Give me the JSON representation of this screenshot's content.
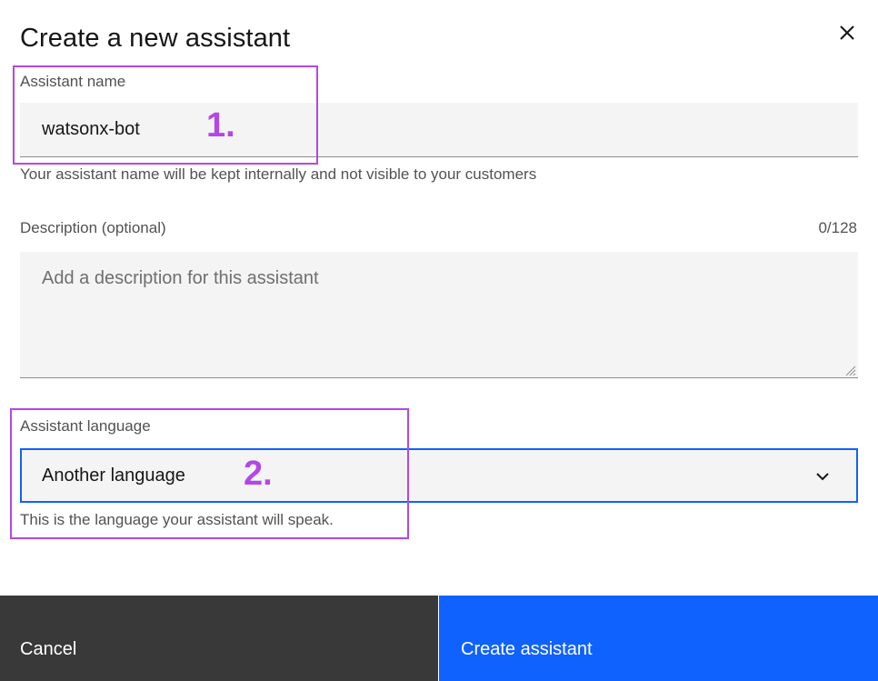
{
  "modal": {
    "title": "Create a new assistant",
    "close_icon": "close-icon"
  },
  "name_field": {
    "label": "Assistant name",
    "value": "watsonx-bot",
    "helper": "Your assistant name will be kept internally and not visible to your customers"
  },
  "description_field": {
    "label": "Description (optional)",
    "counter": "0/128",
    "value": "",
    "placeholder": "Add a description for this assistant"
  },
  "language_field": {
    "label": "Assistant language",
    "selected": "Another language",
    "helper": "This is the language your assistant will speak.",
    "dropdown_icon": "chevron-down-icon"
  },
  "annotations": {
    "step1": "1.",
    "step2": "2.",
    "color": "#b347e6"
  },
  "footer": {
    "cancel_label": "Cancel",
    "create_label": "Create assistant"
  },
  "colors": {
    "primary": "#0f62fe",
    "secondary": "#393939",
    "field_bg": "#f4f4f4"
  }
}
